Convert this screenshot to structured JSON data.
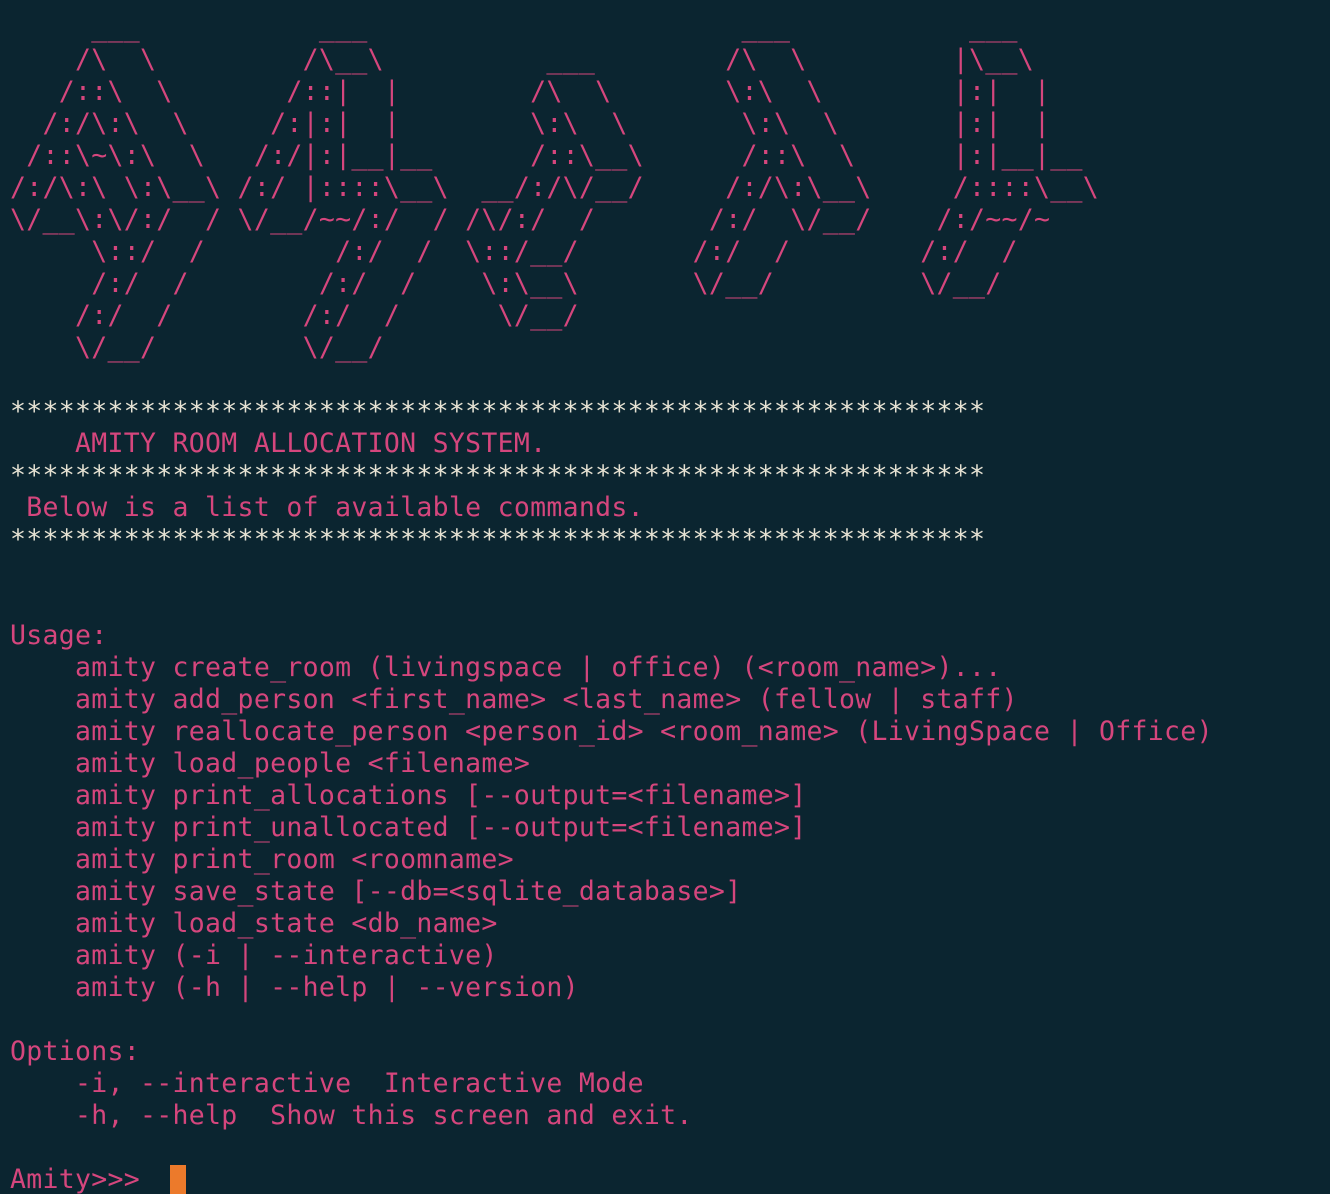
{
  "banner_art": [
    "     ___           ___                       ___           ___",
    "    /\\  \\         /\\__\\          ___        /\\  \\         |\\__\\",
    "   /::\\  \\       /::|  |        /\\  \\       \\:\\  \\        |:|  |",
    "  /:/\\:\\  \\     /:|:|  |        \\:\\  \\       \\:\\  \\       |:|  |",
    " /::\\~\\:\\  \\   /:/|:|__|__      /::\\__\\      /::\\  \\      |:|__|__",
    "/:/\\:\\ \\:\\__\\ /:/ |::::\\__\\  __/:/\\/__/     /:/\\:\\__\\     /::::\\__\\",
    "\\/__\\:\\/:/  / \\/__/~~/:/  / /\\/:/  /       /:/  \\/__/    /:/~~/~",
    "     \\::/  /        /:/  /  \\::/__/       /:/  /        /:/  /",
    "     /:/  /        /:/  /    \\:\\__\\       \\/__/         \\/__/",
    "    /:/  /        /:/  /      \\/__/",
    "    \\/__/         \\/__/"
  ],
  "stars": "************************************************************",
  "system_title": "    AMITY ROOM ALLOCATION SYSTEM.",
  "subtitle": " Below is a list of available commands.",
  "usage_header": "Usage:",
  "usage_lines": [
    "    amity create_room (livingspace | office) (<room_name>)...",
    "    amity add_person <first_name> <last_name> (fellow | staff)",
    "    amity reallocate_person <person_id> <room_name> (LivingSpace | Office)",
    "    amity load_people <filename>",
    "    amity print_allocations [--output=<filename>]",
    "    amity print_unallocated [--output=<filename>]",
    "    amity print_room <roomname>",
    "    amity save_state [--db=<sqlite_database>]",
    "    amity load_state <db_name>",
    "    amity (-i | --interactive)",
    "    amity (-h | --help | --version)"
  ],
  "options_header": "Options:",
  "options_lines": [
    "    -i, --interactive  Interactive Mode",
    "    -h, --help  Show this screen and exit."
  ],
  "prompt": "Amity>>> ",
  "colors": {
    "background": "#0b2530",
    "text": "#d5467d",
    "stars": "#e6e2d3",
    "cursor": "#ec7a2b"
  }
}
